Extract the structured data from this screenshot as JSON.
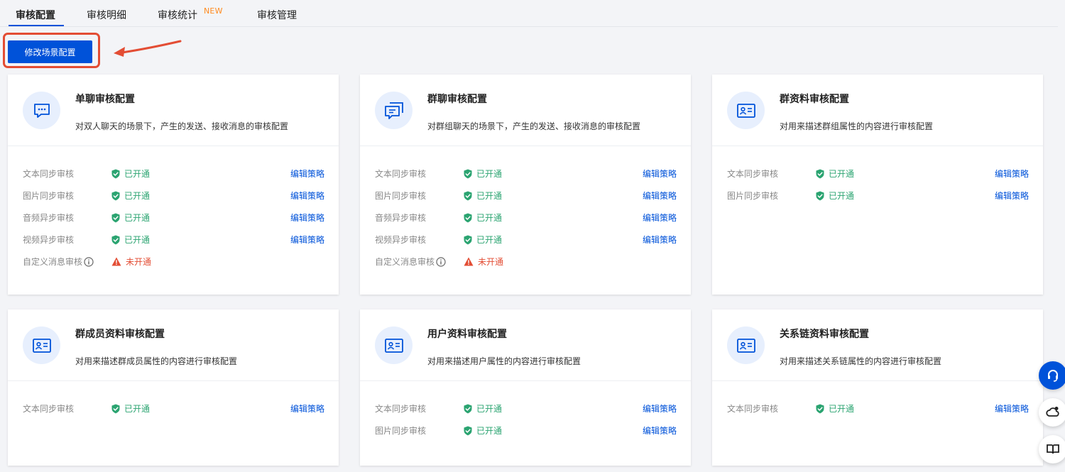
{
  "tabs": [
    {
      "label": "审核配置",
      "active": true
    },
    {
      "label": "审核明细",
      "active": false
    },
    {
      "label": "审核统计",
      "active": false,
      "badge": "NEW"
    },
    {
      "label": "审核管理",
      "active": false
    }
  ],
  "toolbar": {
    "modify_scene_label": "修改场景配置"
  },
  "status_text": {
    "on": "已开通",
    "off": "未开通"
  },
  "edit_label": "编辑策略",
  "colors": {
    "primary": "#0052d9",
    "success": "#2ba471",
    "danger": "#e34d34",
    "badge": "#ff8a1f"
  },
  "cards": [
    {
      "title": "单聊审核配置",
      "desc": "对双人聊天的场景下，产生的发送、接收消息的审核配置",
      "icon": "chat-bubble-icon",
      "rows": [
        {
          "label": "文本同步审核",
          "status": "已开通",
          "edit": "编辑策略"
        },
        {
          "label": "图片同步审核",
          "status": "已开通",
          "edit": "编辑策略"
        },
        {
          "label": "音频异步审核",
          "status": "已开通",
          "edit": "编辑策略"
        },
        {
          "label": "视频异步审核",
          "status": "已开通",
          "edit": "编辑策略"
        },
        {
          "label": "自定义消息审核",
          "status": "未开通",
          "info": true
        }
      ]
    },
    {
      "title": "群聊审核配置",
      "desc": "对群组聊天的场景下，产生的发送、接收消息的审核配置",
      "icon": "group-chat-icon",
      "rows": [
        {
          "label": "文本同步审核",
          "status": "已开通",
          "edit": "编辑策略"
        },
        {
          "label": "图片同步审核",
          "status": "已开通",
          "edit": "编辑策略"
        },
        {
          "label": "音频异步审核",
          "status": "已开通",
          "edit": "编辑策略"
        },
        {
          "label": "视频异步审核",
          "status": "已开通",
          "edit": "编辑策略"
        },
        {
          "label": "自定义消息审核",
          "status": "未开通",
          "info": true
        }
      ]
    },
    {
      "title": "群资料审核配置",
      "desc": "对用来描述群组属性的内容进行审核配置",
      "icon": "profile-card-icon",
      "rows": [
        {
          "label": "文本同步审核",
          "status": "已开通",
          "edit": "编辑策略"
        },
        {
          "label": "图片同步审核",
          "status": "已开通",
          "edit": "编辑策略"
        }
      ]
    },
    {
      "title": "群成员资料审核配置",
      "desc": "对用来描述群成员属性的内容进行审核配置",
      "icon": "profile-card-icon",
      "rows": [
        {
          "label": "文本同步审核",
          "status": "已开通",
          "edit": "编辑策略"
        }
      ]
    },
    {
      "title": "用户资料审核配置",
      "desc": "对用来描述用户属性的内容进行审核配置",
      "icon": "profile-card-icon",
      "rows": [
        {
          "label": "文本同步审核",
          "status": "已开通",
          "edit": "编辑策略"
        },
        {
          "label": "图片同步审核",
          "status": "已开通",
          "edit": "编辑策略"
        }
      ]
    },
    {
      "title": "关系链资料审核配置",
      "desc": "对用来描述关系链属性的内容进行审核配置",
      "icon": "profile-card-icon",
      "rows": [
        {
          "label": "文本同步审核",
          "status": "已开通",
          "edit": "编辑策略"
        }
      ]
    }
  ],
  "side_buttons": [
    {
      "icon": "headset-icon"
    },
    {
      "icon": "cloud-user-icon"
    },
    {
      "icon": "book-icon"
    }
  ]
}
